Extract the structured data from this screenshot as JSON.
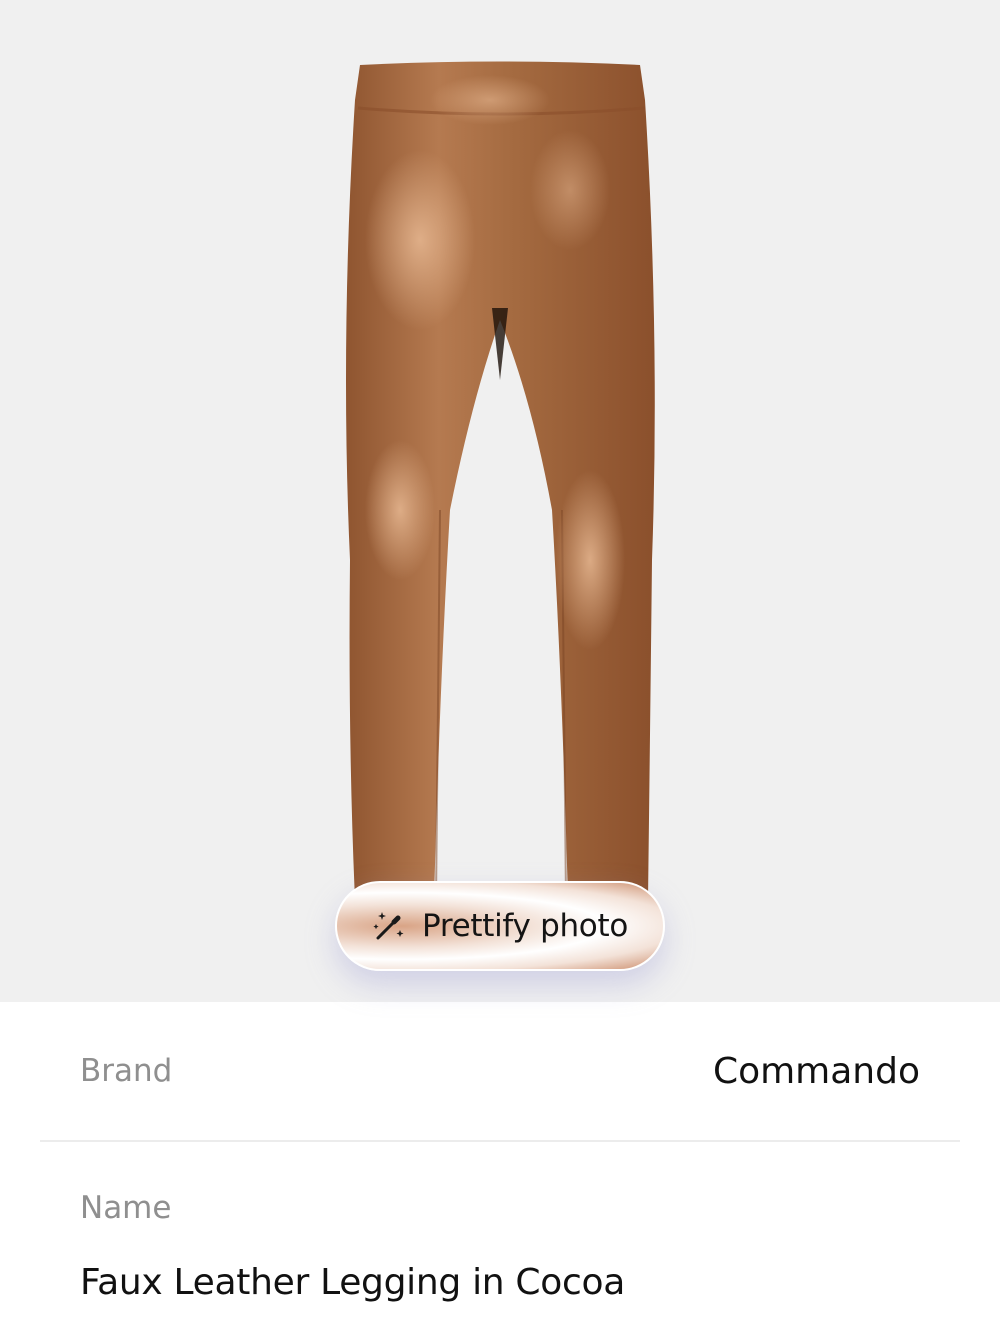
{
  "product_photo": {
    "icon": "leggings-product-image",
    "background_color": "#f0f0f0",
    "garment_color": "#a8693f"
  },
  "prettify": {
    "label": "Prettify photo",
    "icon": "magic-wand-icon"
  },
  "details": {
    "brand": {
      "label": "Brand",
      "value": "Commando"
    },
    "name": {
      "label": "Name",
      "value": "Faux Leather Legging in Cocoa"
    }
  }
}
